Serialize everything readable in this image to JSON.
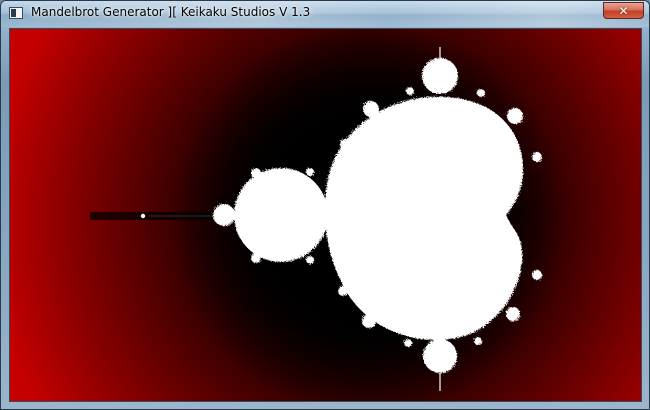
{
  "window": {
    "title": "Mandelbrot Generator ][ Keikaku Studios V 1.3",
    "icon": "app-window-icon"
  },
  "controls": {
    "close_icon": "close-icon",
    "close_glyph": "✕"
  },
  "canvas": {
    "content": "mandelbrot-set-render",
    "colors": {
      "set": "#ffffff",
      "near": "#000000",
      "far": "#c40000"
    }
  }
}
